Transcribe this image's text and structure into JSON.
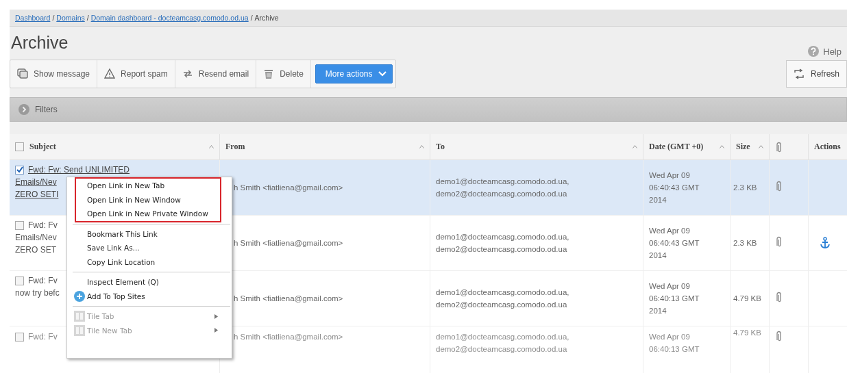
{
  "breadcrumb": [
    {
      "label": "Dashboard",
      "kind": "link"
    },
    {
      "label": "/",
      "kind": "separator"
    },
    {
      "label": "Domains",
      "kind": "link"
    },
    {
      "label": "/",
      "kind": "separator"
    },
    {
      "label": "Domain dashboard - docteamcasg.comodo.od.ua",
      "kind": "link"
    },
    {
      "label": "/",
      "kind": "separator"
    },
    {
      "label": "Archive",
      "kind": "current"
    }
  ],
  "title": "Archive",
  "help": "Help",
  "toolbar": [
    {
      "label": "Show message",
      "kind": "message"
    },
    {
      "label": "Report spam",
      "kind": "warning"
    },
    {
      "label": "Resend email",
      "kind": "resend"
    },
    {
      "label": "Delete",
      "kind": "trash"
    },
    {
      "label": "More actions",
      "kind": "dropdown"
    }
  ],
  "refresh": "Refresh",
  "filters": "Filters",
  "table": {
    "columns": [
      {
        "label": "Subject",
        "kind": "checkbox",
        "checked": false,
        "sortable": true
      },
      {
        "label": "From",
        "kind": "text",
        "sortable": true
      },
      {
        "label": "To",
        "kind": "text",
        "sortable": true
      },
      {
        "label": "Date (GMT +0)",
        "kind": "text",
        "sortable": true
      },
      {
        "label": "Size",
        "kind": "text",
        "sortable": true
      },
      {
        "kind": "clip"
      },
      {
        "label": "Actions",
        "kind": "text"
      }
    ],
    "rows": [
      {
        "selected": true,
        "checked": true,
        "faded": false,
        "subject": [
          "Fwd: Fw: Send UNLIMITED",
          "Emails/Nev",
          "ZERO SETI"
        ],
        "subject_link": true,
        "from": "h Smith <fiatliena@gmail.com>",
        "to": [
          "demo1@docteamcasg.comodo.od.ua,",
          "demo2@docteamcasg.comodo.od.ua"
        ],
        "date": [
          "Wed Apr 09",
          "06:40:43 GMT",
          "2014"
        ],
        "size": "2.3 KB",
        "attachment": true,
        "action_icon": false
      },
      {
        "selected": false,
        "checked": false,
        "faded": false,
        "subject": [
          "Fwd: Fv",
          "Emails/Nev",
          "ZERO SET"
        ],
        "subject_link": false,
        "from": "h Smith <fiatliena@gmail.com>",
        "to": [
          "demo1@docteamcasg.comodo.od.ua,",
          "demo2@docteamcasg.comodo.od.ua"
        ],
        "date": [
          "Wed Apr 09",
          "06:40:43 GMT",
          "2014"
        ],
        "size": "2.3 KB",
        "attachment": true,
        "action_icon": true
      },
      {
        "selected": false,
        "checked": false,
        "faded": false,
        "subject": [
          "Fwd: Fv",
          "now try befc"
        ],
        "subject_link": false,
        "from": "h Smith <fiatliena@gmail.com>",
        "to": [
          "demo1@docteamcasg.comodo.od.ua,",
          "demo2@docteamcasg.comodo.od.ua"
        ],
        "date": [
          "Wed Apr 09",
          "06:40:13 GMT",
          "2014"
        ],
        "size": "4.79 KB",
        "attachment": true,
        "action_icon": false
      },
      {
        "selected": false,
        "checked": false,
        "faded": true,
        "subject": [
          "Fwd: Fv"
        ],
        "subject_link": false,
        "from": "h Smith <fiatliena@gmail.com>",
        "to": [
          "demo1@docteamcasg.comodo.od.ua,",
          "demo2@docteamcasg.comodo.od.ua"
        ],
        "date": [
          "Wed Apr 09",
          "06:40:13 GMT"
        ],
        "size": "4.79 KB",
        "attachment": true,
        "action_icon": false
      }
    ]
  },
  "context_menu": {
    "sections": [
      {
        "highlighted": true,
        "items": [
          {
            "label": "Open Link in New Tab",
            "kind": "plain",
            "disabled": false
          },
          {
            "label": "Open Link in New Window",
            "kind": "plain",
            "disabled": false
          },
          {
            "label": "Open Link in New Private Window",
            "kind": "plain",
            "disabled": false
          }
        ]
      },
      {
        "highlighted": false,
        "items": [
          {
            "label": "Bookmark This Link",
            "kind": "plain",
            "disabled": false
          },
          {
            "label": "Save Link As...",
            "kind": "plain",
            "disabled": false
          },
          {
            "label": "Copy Link Location",
            "kind": "plain",
            "disabled": false
          }
        ]
      },
      {
        "highlighted": false,
        "items": [
          {
            "label": "Inspect Element (Q)",
            "kind": "plain",
            "disabled": false
          },
          {
            "label": "Add To Top Sites",
            "kind": "plus",
            "disabled": false
          }
        ]
      },
      {
        "highlighted": false,
        "items": [
          {
            "label": "Tile Tab",
            "kind": "tile",
            "disabled": true,
            "submenu": true
          },
          {
            "label": "Tile New Tab",
            "kind": "tile",
            "disabled": true,
            "submenu": true
          }
        ]
      }
    ]
  }
}
